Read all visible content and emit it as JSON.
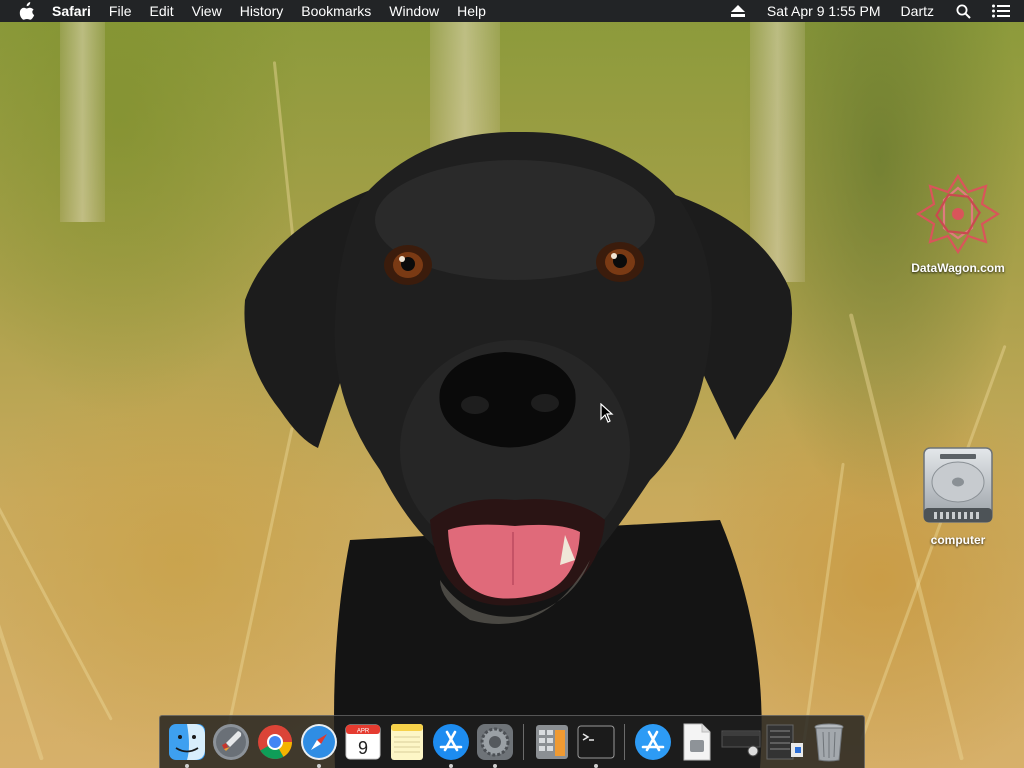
{
  "menubar": {
    "apple_icon": "apple-icon",
    "app_name": "Safari",
    "menus": [
      "File",
      "Edit",
      "View",
      "History",
      "Bookmarks",
      "Window",
      "Help"
    ],
    "eject_icon": "eject-icon",
    "datetime": "Sat Apr 9  1:55 PM",
    "user": "Dartz",
    "search_icon": "search-icon",
    "notifications_icon": "list-icon"
  },
  "desktop": {
    "icons": [
      {
        "label": "DataWagon.com",
        "icon": "datawagon-logo-icon"
      },
      {
        "label": "computer",
        "icon": "hard-drive-icon"
      }
    ]
  },
  "dock": {
    "calendar_month": "APR",
    "calendar_day": "9",
    "items": [
      {
        "name": "finder",
        "running": true
      },
      {
        "name": "launchpad",
        "running": false
      },
      {
        "name": "chrome",
        "running": false
      },
      {
        "name": "safari",
        "running": true
      },
      {
        "name": "calendar",
        "running": false
      },
      {
        "name": "notes",
        "running": false
      },
      {
        "name": "app-store",
        "running": true
      },
      {
        "name": "system-preferences",
        "running": true
      },
      {
        "name": "calculator",
        "running": false
      },
      {
        "name": "terminal",
        "running": true
      },
      {
        "name": "downloads",
        "running": false
      },
      {
        "name": "documents",
        "running": false
      },
      {
        "name": "screenshot",
        "running": false
      },
      {
        "name": "files-stack",
        "running": false
      },
      {
        "name": "trash",
        "running": false
      }
    ]
  }
}
